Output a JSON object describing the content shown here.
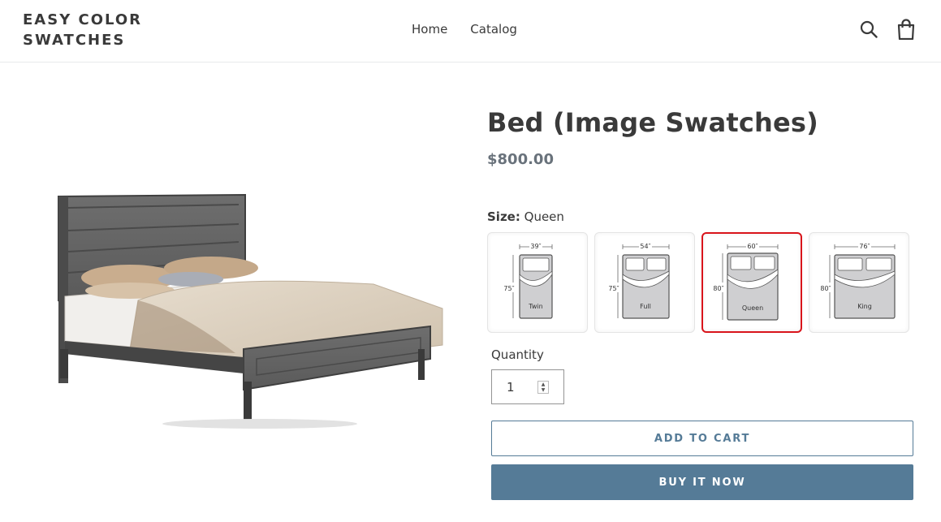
{
  "header": {
    "logo_line1": "EASY COLOR",
    "logo_line2": "SWATCHES",
    "nav": [
      {
        "label": "Home"
      },
      {
        "label": "Catalog"
      }
    ],
    "icons": [
      "search-icon",
      "cart-icon"
    ]
  },
  "product": {
    "title": "Bed (Image Swatches)",
    "price": "$800.00",
    "option_name": "Size:",
    "option_value": "Queen",
    "swatches": [
      {
        "name": "Twin",
        "width": "39″",
        "length": "75″",
        "selected": false
      },
      {
        "name": "Full",
        "width": "54″",
        "length": "75″",
        "selected": false
      },
      {
        "name": "Queen",
        "width": "60″",
        "length": "80″",
        "selected": true
      },
      {
        "name": "King",
        "width": "76″",
        "length": "80″",
        "selected": false
      }
    ],
    "quantity_label": "Quantity",
    "quantity_value": "1",
    "add_to_cart": "ADD TO CART",
    "buy_now": "BUY IT NOW"
  },
  "colors": {
    "accent": "#557b97",
    "selected_border": "#d9141b"
  }
}
